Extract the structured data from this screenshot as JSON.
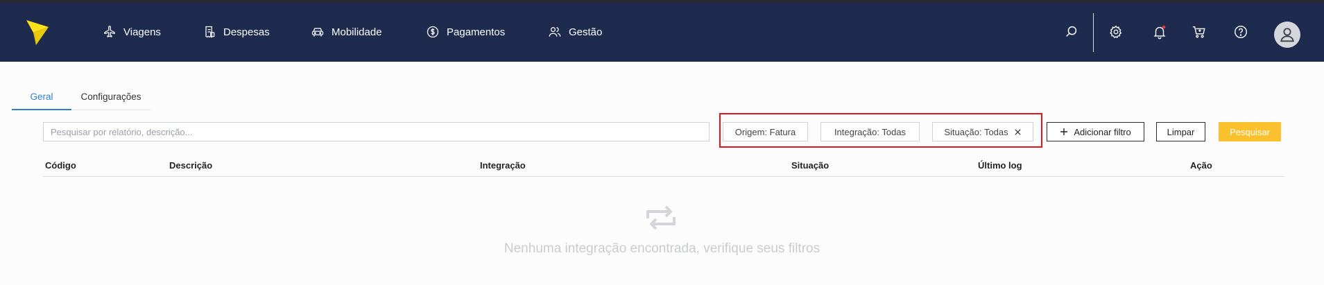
{
  "nav": {
    "items": [
      {
        "label": "Viagens",
        "icon": "plane-icon"
      },
      {
        "label": "Despesas",
        "icon": "receipt-icon"
      },
      {
        "label": "Mobilidade",
        "icon": "car-icon"
      },
      {
        "label": "Pagamentos",
        "icon": "dollar-circle-icon"
      },
      {
        "label": "Gestão",
        "icon": "users-icon"
      }
    ],
    "right_icons": [
      "search-icon",
      "gear-icon",
      "bell-icon",
      "cart-icon",
      "help-icon",
      "avatar-icon"
    ],
    "colors": {
      "background": "#1f2b4e",
      "logo": "#fde21b",
      "notification_dot": "#e53935"
    }
  },
  "tabs": [
    {
      "label": "Geral",
      "active": true
    },
    {
      "label": "Configurações",
      "active": false
    }
  ],
  "search": {
    "placeholder": "Pesquisar por relatório, descrição...",
    "value": ""
  },
  "filters": [
    {
      "label": "Origem: Fatura",
      "removable": false
    },
    {
      "label": "Integração: Todas",
      "removable": false
    },
    {
      "label": "Situação: Todas",
      "removable": true
    }
  ],
  "actions": {
    "add_filter": "Adicionar filtro",
    "clear": "Limpar",
    "search": "Pesquisar"
  },
  "table": {
    "columns": [
      "Código",
      "Descrição",
      "Integração",
      "Situação",
      "Último log",
      "Ação"
    ],
    "rows": []
  },
  "empty_state": {
    "icon": "repeat-icon",
    "message": "Nenhuma integração encontrada, verifique seus filtros"
  },
  "colors": {
    "accent": "#2f7fd0",
    "primary_button": "#fbc02d",
    "highlight": "#e3141b"
  }
}
